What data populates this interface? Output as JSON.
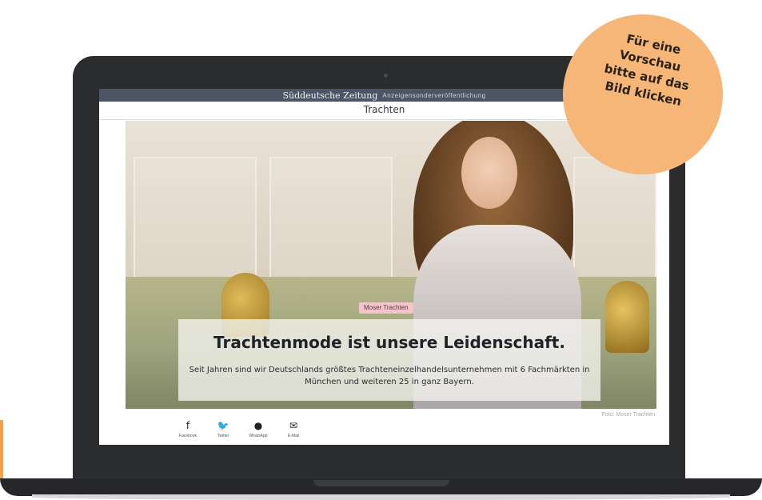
{
  "promo_badge": {
    "lines": [
      "Für eine",
      "Vorschau",
      "bitte auf das",
      "Bild klicken"
    ]
  },
  "header": {
    "logo_text": "Süddeutsche Zeitung",
    "subtitle": "Anzeigensonderveröffentlichung",
    "section_title": "Trachten"
  },
  "hero": {
    "tag": "Moser Trachten",
    "headline": "Trachtenmode ist unsere Leidenschaft.",
    "subtext": "Seit Jahren sind wir Deutschlands größtes Trachteneinzelhandelsunternehmen mit 6 Fachmärkten in München und weiteren 25 in ganz Bayern.",
    "photo_credit": "Foto: Moser Trachten"
  },
  "share": {
    "items": [
      {
        "label": "Facebook",
        "icon": "facebook-icon",
        "glyph": "f"
      },
      {
        "label": "Twitter",
        "icon": "twitter-icon",
        "glyph": "🐦"
      },
      {
        "label": "WhatsApp",
        "icon": "whatsapp-icon",
        "glyph": "●"
      },
      {
        "label": "E-Mail",
        "icon": "mail-icon",
        "glyph": "✉"
      }
    ]
  },
  "colors": {
    "badge": "#f6b677",
    "topbar": "#4b5563",
    "tag_bg": "#f3c4c9"
  }
}
